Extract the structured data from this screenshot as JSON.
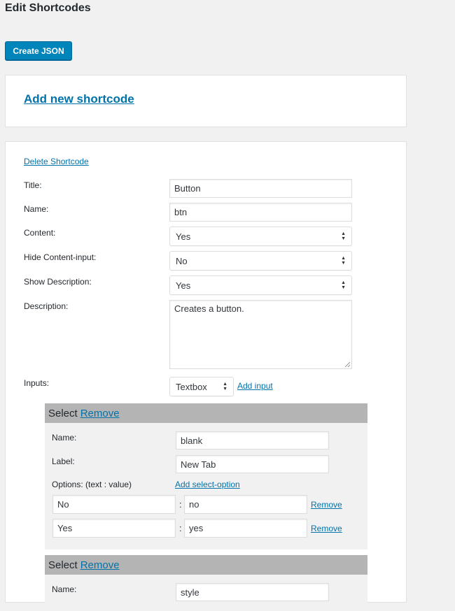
{
  "page": {
    "title": "Edit Shortcodes"
  },
  "toolbar": {
    "create_json_label": "Create JSON"
  },
  "add_card": {
    "link_label": "Add new shortcode"
  },
  "shortcode": {
    "delete_label": "Delete Shortcode",
    "title_label": "Title:",
    "title_value": "Button",
    "name_label": "Name:",
    "name_value": "btn",
    "content_label": "Content:",
    "content_value": "Yes",
    "hide_content_label": "Hide Content-input:",
    "hide_content_value": "No",
    "show_desc_label": "Show Description:",
    "show_desc_value": "Yes",
    "description_label": "Description:",
    "description_value": "Creates a button.",
    "inputs_label": "Inputs:",
    "inputs_type_value": "Textbox",
    "add_input_label": "Add input"
  },
  "input_blocks": [
    {
      "type": "Select",
      "remove_label": "Remove",
      "name_label": "Name:",
      "name_value": "blank",
      "label_label": "Label:",
      "label_value": "New Tab",
      "options_label": "Options: (text : value)",
      "add_option_label": "Add select-option",
      "options": [
        {
          "text": "No",
          "sep": ":",
          "value": "no",
          "remove_label": "Remove"
        },
        {
          "text": "Yes",
          "sep": ":",
          "value": "yes",
          "remove_label": "Remove"
        }
      ]
    },
    {
      "type": "Select",
      "remove_label": "Remove",
      "name_label": "Name:",
      "name_value": "style"
    }
  ]
}
